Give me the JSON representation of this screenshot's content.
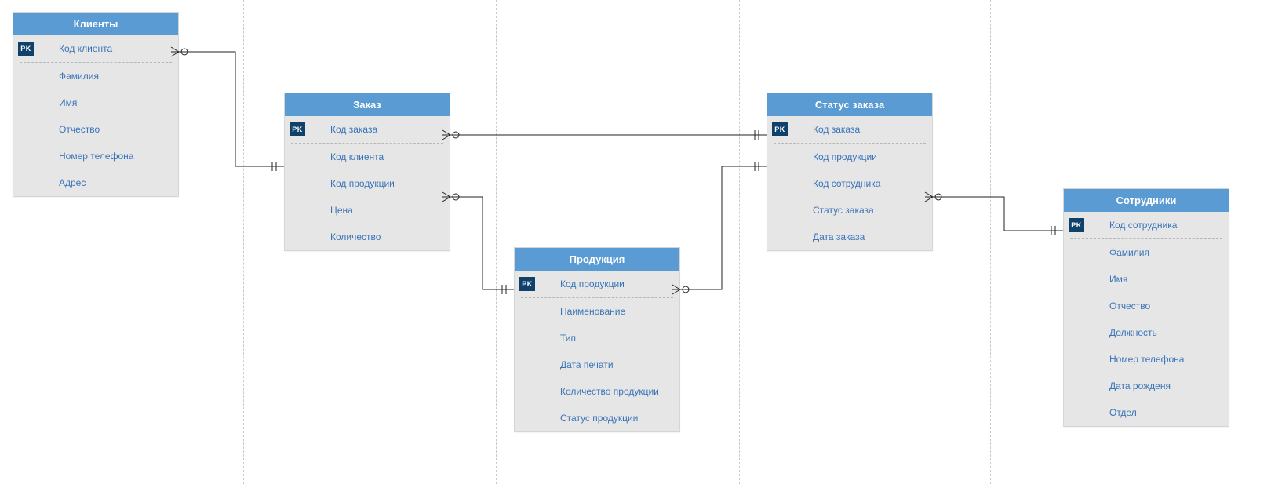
{
  "badges": {
    "pk": "PK"
  },
  "entities": {
    "clients": {
      "title": "Клиенты",
      "pk": "Код клиента",
      "fields": [
        "Фамилия",
        "Имя",
        "Отчество",
        "Номер телефона",
        "Адрес"
      ]
    },
    "order": {
      "title": "Заказ",
      "pk": "Код заказа",
      "fields": [
        "Код клиента",
        "Код продукции",
        "Цена",
        "Количество"
      ]
    },
    "product": {
      "title": "Продукция",
      "pk": "Код продукции",
      "fields": [
        "Наименование",
        "Тип",
        "Дата печати",
        "Количество продукции",
        "Статус продукции"
      ]
    },
    "status": {
      "title": "Статус заказа",
      "pk": "Код заказа",
      "fields": [
        "Код продукции",
        "Код сотрудника",
        "Статус заказа",
        "Дата заказа"
      ]
    },
    "employees": {
      "title": "Сотрудники",
      "pk": "Код сотрудника",
      "fields": [
        "Фамилия",
        "Имя",
        "Отчество",
        "Должность",
        "Номер телефона",
        "Дата рожденя",
        "Отдел"
      ]
    }
  },
  "relationships": [
    {
      "from": "clients.Код клиента",
      "to": "order.Код клиента",
      "type": "one-to-many"
    },
    {
      "from": "order.Код заказа",
      "to": "status.Код заказа",
      "type": "one-to-many"
    },
    {
      "from": "order.Код продукции",
      "to": "product.Код продукции",
      "type": "many-to-one"
    },
    {
      "from": "product.Код продукции",
      "to": "status.Код продукции",
      "type": "one-to-many"
    },
    {
      "from": "employees.Код сотрудника",
      "to": "status.Код сотрудника",
      "type": "one-to-many"
    }
  ]
}
